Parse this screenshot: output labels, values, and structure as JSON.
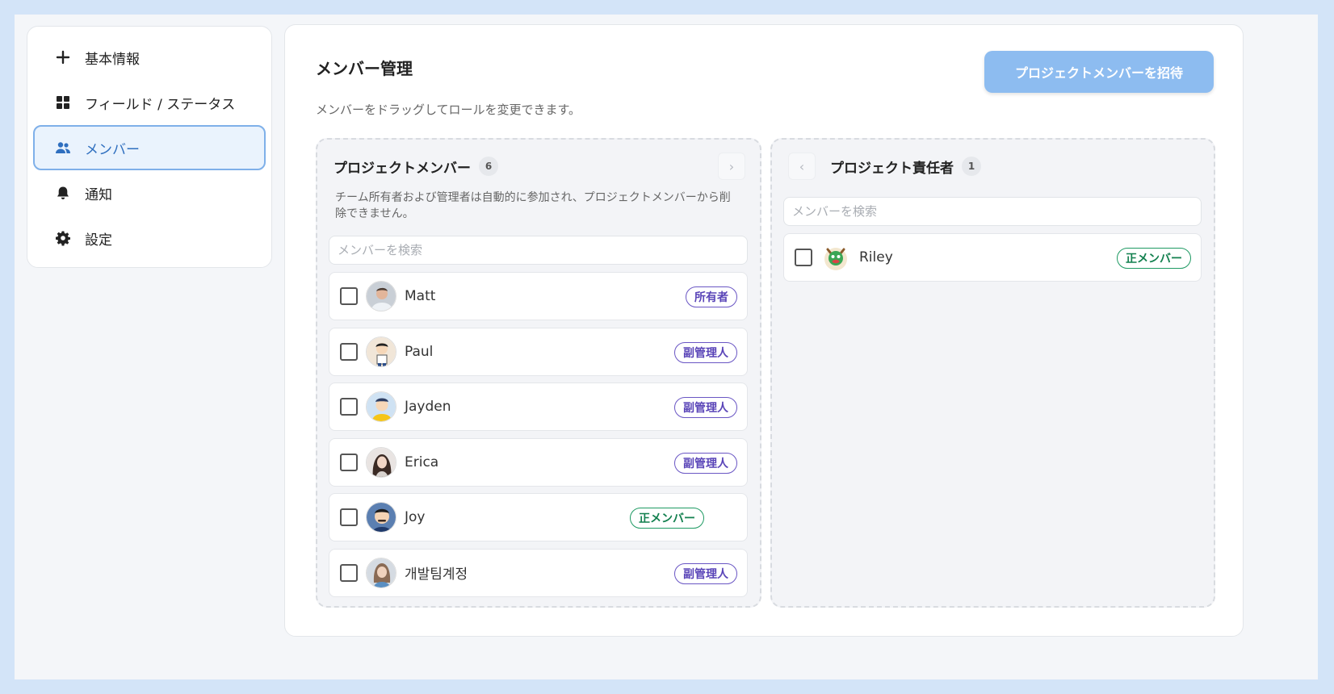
{
  "sidebar": {
    "items": [
      {
        "label": "基本情報",
        "icon": "plus-icon"
      },
      {
        "label": "フィールド / ステータス",
        "icon": "grid-icon"
      },
      {
        "label": "メンバー",
        "icon": "users-icon",
        "active": true
      },
      {
        "label": "通知",
        "icon": "bell-icon"
      },
      {
        "label": "設定",
        "icon": "gear-icon"
      }
    ]
  },
  "main": {
    "title": "メンバー管理",
    "subtitle": "メンバーをドラッグしてロールを変更できます。",
    "invite_button": "プロジェクトメンバーを招待"
  },
  "members_column": {
    "title": "プロジェクトメンバー",
    "count": "6",
    "next_arrow": "›",
    "description": "チーム所有者および管理者は自動的に参加され、プロジェクトメンバーから削除できません。",
    "search_placeholder": "メンバーを検索",
    "members": [
      {
        "name": "Matt",
        "role": "所有者",
        "role_type": "purple"
      },
      {
        "name": "Paul",
        "role": "副管理人",
        "role_type": "purple"
      },
      {
        "name": "Jayden",
        "role": "副管理人",
        "role_type": "purple"
      },
      {
        "name": "Erica",
        "role": "副管理人",
        "role_type": "purple"
      },
      {
        "name": "Joy",
        "role": "正メンバー",
        "role_type": "green"
      },
      {
        "name": "개발팀계정",
        "role": "副管理人",
        "role_type": "purple"
      }
    ]
  },
  "owners_column": {
    "title": "プロジェクト責任者",
    "count": "1",
    "prev_arrow": "‹",
    "search_placeholder": "メンバーを検索",
    "members": [
      {
        "name": "Riley",
        "role": "正メンバー",
        "role_type": "green"
      }
    ]
  },
  "colors": {
    "accent": "#8dbcf0",
    "active_border": "#7fb0e9",
    "role_purple": "#5a45b8",
    "role_green": "#13804f"
  }
}
